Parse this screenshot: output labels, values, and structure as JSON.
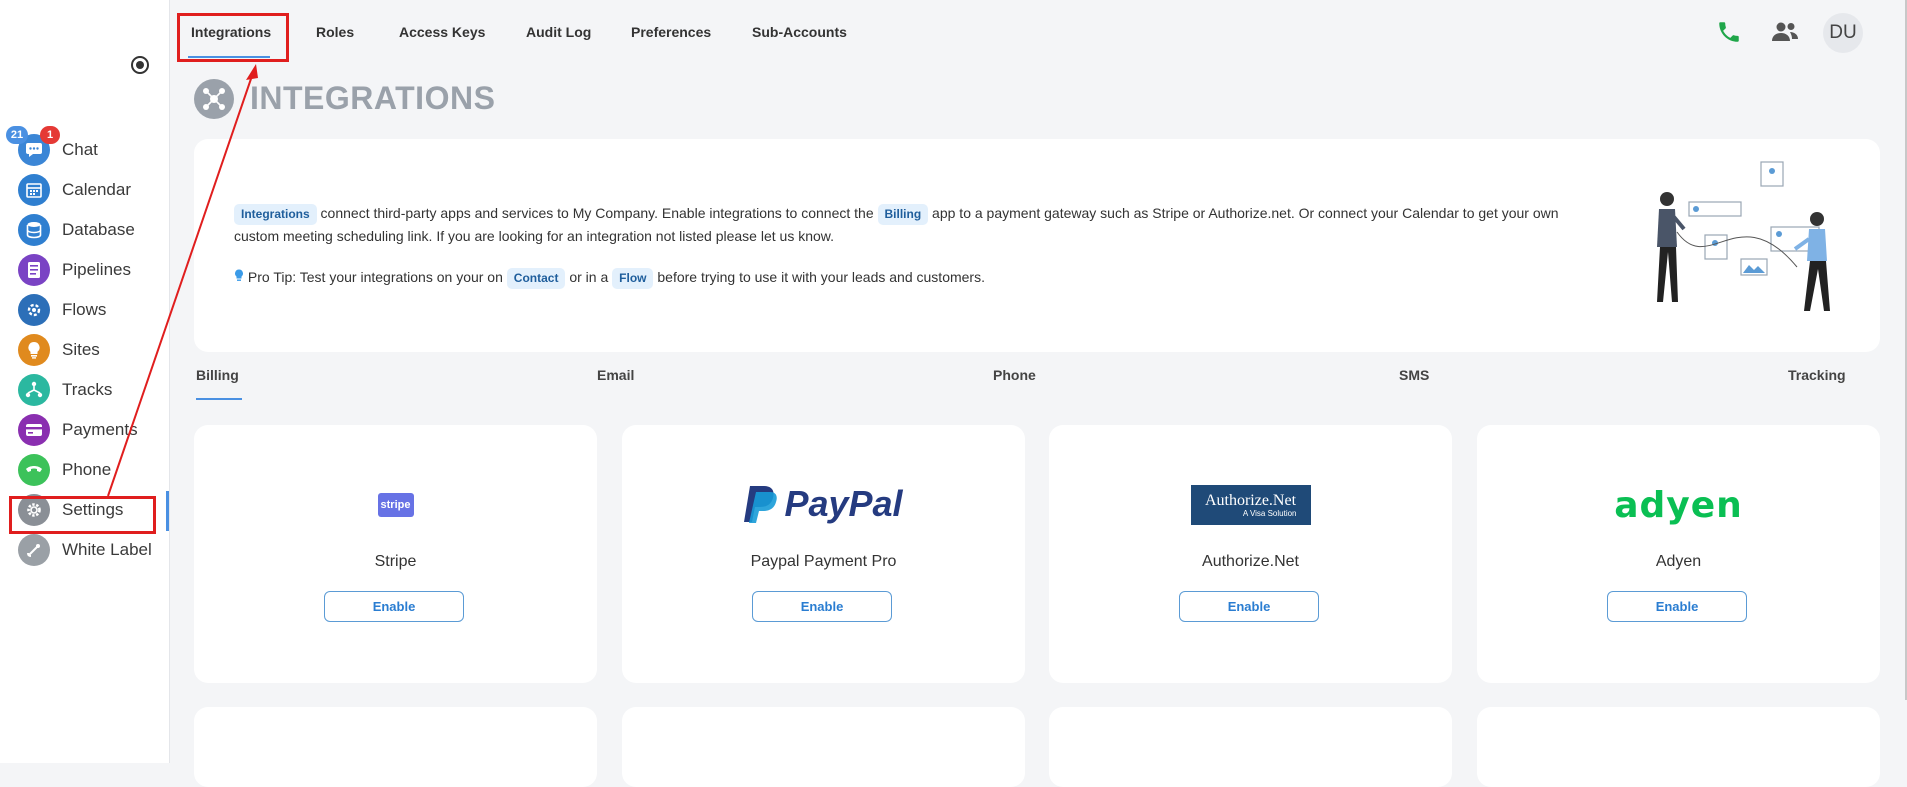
{
  "sidebar": {
    "badges": {
      "chat_count": "21",
      "chat_alert": "1"
    },
    "items": [
      {
        "label": "Chat",
        "icon": "chat-icon",
        "color": "#3b86d6"
      },
      {
        "label": "Calendar",
        "icon": "calendar-icon",
        "color": "#2f7fd0"
      },
      {
        "label": "Database",
        "icon": "database-icon",
        "color": "#2f7fd0"
      },
      {
        "label": "Pipelines",
        "icon": "pipelines-icon",
        "color": "#7a43c4"
      },
      {
        "label": "Flows",
        "icon": "flows-icon",
        "color": "#2c6fb8"
      },
      {
        "label": "Sites",
        "icon": "sites-icon",
        "color": "#e08a1e"
      },
      {
        "label": "Tracks",
        "icon": "tracks-icon",
        "color": "#2bb8a0"
      },
      {
        "label": "Payments",
        "icon": "payments-icon",
        "color": "#8a2fb0"
      },
      {
        "label": "Phone",
        "icon": "phone-icon",
        "color": "#3cc25a"
      },
      {
        "label": "Settings",
        "icon": "gear-icon",
        "color": "#8a8f96"
      },
      {
        "label": "White Label",
        "icon": "white-label-icon",
        "color": "#9aa0a6"
      }
    ]
  },
  "tabs": [
    "Integrations",
    "Roles",
    "Access Keys",
    "Audit Log",
    "Preferences",
    "Sub-Accounts"
  ],
  "header": {
    "avatar_initials": "DU",
    "phone_color": "#1fa64a"
  },
  "page": {
    "title": "INTEGRATIONS"
  },
  "info": {
    "chip_integrations": "Integrations",
    "text_1": " connect third-party apps and services to My Company. Enable integrations to connect the ",
    "chip_billing": "Billing",
    "text_2": " app to a payment gateway such as Stripe or Authorize.net. Or connect your Calendar to get your own custom meeting scheduling link. If you are looking for an integration not listed please let us know.",
    "tip_1": " Pro Tip: Test your integrations on your on ",
    "chip_contact": "Contact",
    "tip_2": " or in a ",
    "chip_flow": "Flow",
    "tip_3": " before trying to use it with your leads and customers."
  },
  "categories": [
    "Billing",
    "Email",
    "Phone",
    "SMS",
    "Tracking"
  ],
  "integrations": [
    {
      "name": "Stripe",
      "logo_text": "stripe",
      "button": "Enable"
    },
    {
      "name": "Paypal Payment Pro",
      "logo_text": "PayPal",
      "button": "Enable"
    },
    {
      "name": "Authorize.Net",
      "logo_text": "Authorize.Net",
      "logo_sub": "A Visa Solution",
      "button": "Enable"
    },
    {
      "name": "Adyen",
      "logo_text": "adyen",
      "button": "Enable"
    }
  ]
}
